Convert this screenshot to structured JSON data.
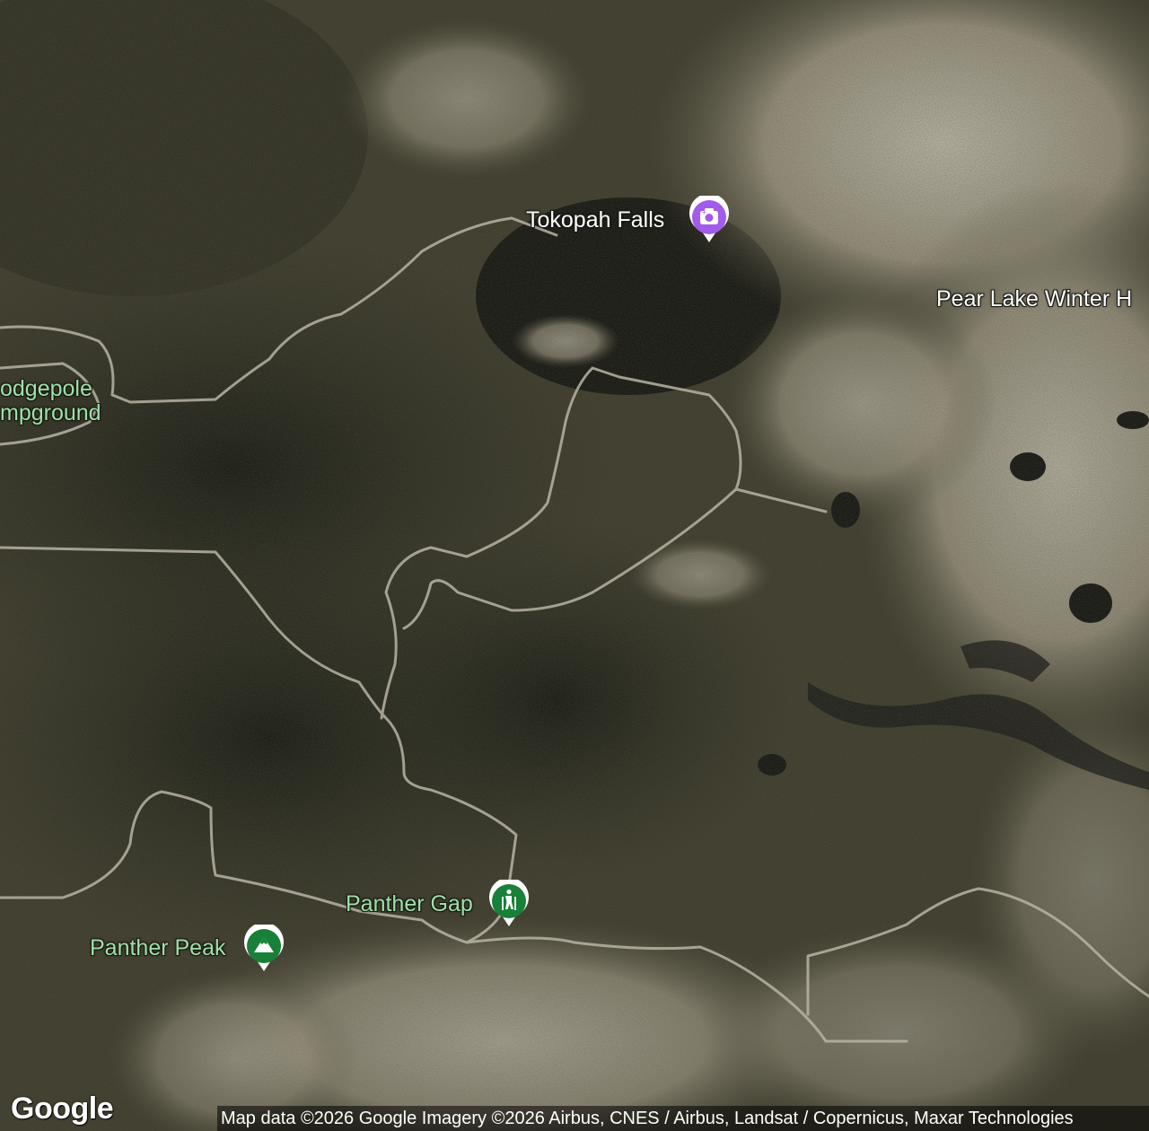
{
  "map": {
    "type": "satellite",
    "places": {
      "tokopah_falls": {
        "name": "Tokopah Falls",
        "icon": "camera-icon",
        "color": "#a25bea"
      },
      "pear_lake": {
        "name": "Pear Lake Winter H"
      },
      "lodgepole": {
        "line1": "odgepole",
        "line2": "mpground"
      },
      "panther_gap": {
        "name": "Panther Gap",
        "icon": "hiker-icon",
        "color": "#188038"
      },
      "panther_peak": {
        "name": "Panther Peak",
        "icon": "mountain-icon",
        "color": "#188038"
      }
    },
    "logo": "Google",
    "attribution": "Map data ©2026 Google Imagery ©2026 Airbus, CNES / Airbus, Landsat / Copernicus, Maxar Technologies"
  }
}
